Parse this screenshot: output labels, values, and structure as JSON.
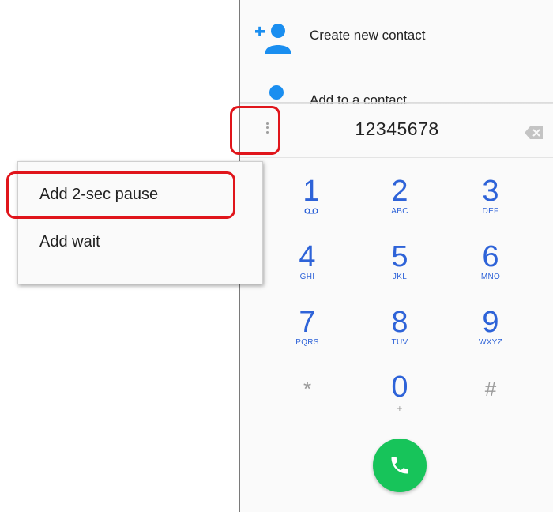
{
  "suggestions": {
    "create_contact": "Create new contact",
    "add_to_contact": "Add to a contact"
  },
  "dialer": {
    "number": "12345678",
    "keys": [
      {
        "digit": "1",
        "letters": ""
      },
      {
        "digit": "2",
        "letters": "ABC"
      },
      {
        "digit": "3",
        "letters": "DEF"
      },
      {
        "digit": "4",
        "letters": "GHI"
      },
      {
        "digit": "5",
        "letters": "JKL"
      },
      {
        "digit": "6",
        "letters": "MNO"
      },
      {
        "digit": "7",
        "letters": "PQRS"
      },
      {
        "digit": "8",
        "letters": "TUV"
      },
      {
        "digit": "9",
        "letters": "WXYZ"
      },
      {
        "digit": "*",
        "letters": ""
      },
      {
        "digit": "0",
        "letters": "+"
      },
      {
        "digit": "#",
        "letters": ""
      }
    ]
  },
  "overflow_menu": {
    "items": [
      "Add 2-sec pause",
      "Add wait"
    ]
  },
  "colors": {
    "accent_blue": "#2e63d8",
    "call_green": "#17c45a",
    "highlight_red": "#e0151b"
  },
  "icons": {
    "create_contact": "add-person-icon",
    "add_contact": "person-icon",
    "overflow": "more-vert-icon",
    "backspace": "backspace-icon",
    "voicemail": "voicemail-icon",
    "call": "phone-icon"
  }
}
